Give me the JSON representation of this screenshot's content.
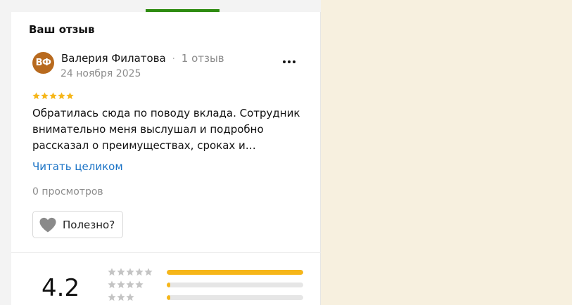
{
  "review": {
    "section_title": "Ваш отзыв",
    "avatar_initials": "ВФ",
    "author_name": "Валерия Филатова",
    "separator": "·",
    "author_review_count": "1 отзыв",
    "date": "24 ноября 2025",
    "stars": 5,
    "text": "Обратилась сюда по поводу вклада. Сотрудник внимательно меня выслушал и подробно рассказал о преимуществах, сроках и…",
    "read_more_label": "Читать целиком",
    "views_label": "0 просмотров",
    "useful_label": "Полезно?"
  },
  "rating_summary": {
    "value": "4.2",
    "distribution": [
      {
        "stars": 5,
        "fraction": 1.0
      },
      {
        "stars": 4,
        "fraction": 0.02
      },
      {
        "stars": 3,
        "fraction": 0.02
      }
    ]
  },
  "icons": {
    "more": "more-horizontal-icon",
    "heart": "heart-icon",
    "star": "star-icon"
  },
  "colors": {
    "accent_green": "#2e8b10",
    "star_gold": "#f6b619",
    "link_blue": "#1b73c6",
    "avatar_brown": "#b86a1e",
    "right_background": "#f7f0df"
  }
}
